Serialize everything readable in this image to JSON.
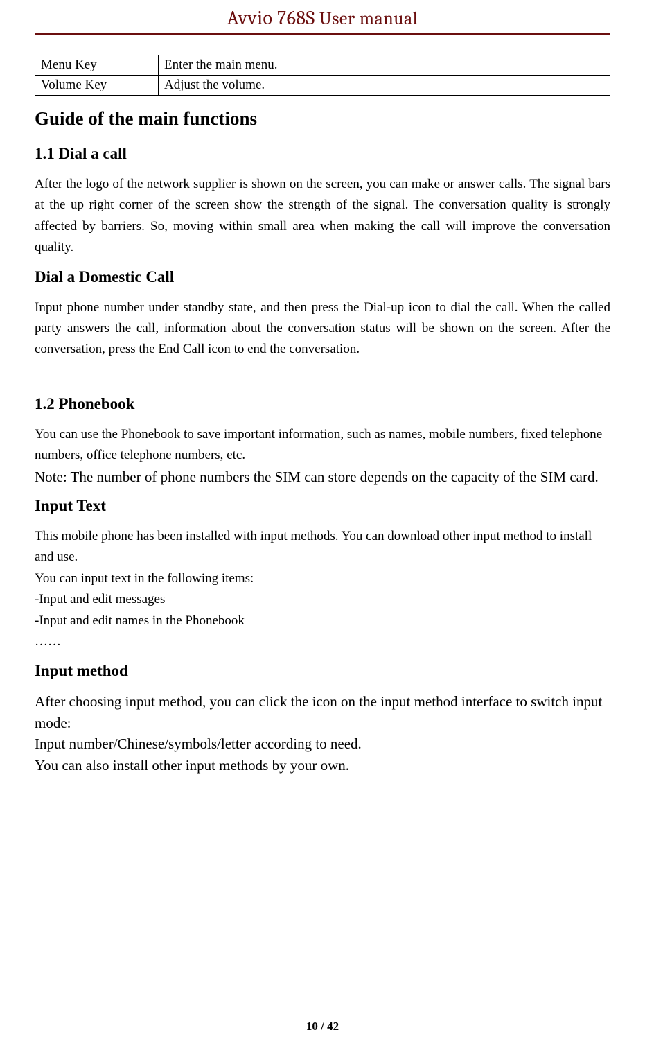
{
  "header": {
    "title_model": "Avvio 768S",
    "title_manual": " User manual"
  },
  "table": {
    "rows": [
      {
        "key": "Menu Key",
        "desc": "Enter the main menu."
      },
      {
        "key": "Volume Key",
        "desc": "Adjust the volume."
      }
    ]
  },
  "section": {
    "main_title": "Guide of the main functions",
    "s1_1_title": "1.1 Dial a call",
    "s1_1_para": "After the logo of the network supplier is shown on the screen, you can make or answer calls. The signal bars at the up right corner of the screen show the strength of the signal. The conversation quality is strongly affected by barriers. So, moving within small area when making the call will improve the conversation quality.",
    "domestic_title": "Dial a Domestic Call",
    "domestic_para": "Input phone number under standby state, and then press the Dial-up icon to dial the call. When the called party answers the call, information about the conversation status will be shown on the screen. After the conversation, press the End Call icon to end the conversation.",
    "s1_2_title": "1.2 Phonebook",
    "s1_2_para": "You can use the Phonebook to save important information, such as names, mobile numbers, fixed telephone numbers, office telephone numbers, etc.",
    "s1_2_note": "Note: The number of phone numbers the SIM can store depends on the capacity of the SIM card.",
    "input_text_title": "Input Text",
    "input_text_para1": "This mobile phone has been installed with input methods. You can download other input method to install and use.",
    "input_text_para2": "You can input text in the following items:",
    "input_text_item1": "-Input and edit messages",
    "input_text_item2": "-Input and edit names in the Phonebook",
    "input_text_ellipsis": "……",
    "input_method_title": "Input method",
    "input_method_para1": "After choosing input method, you can click the icon on the input method interface to switch input mode:",
    "input_method_para2": "Input number/Chinese/symbols/letter according to need.",
    "input_method_para3": "You can also install other input methods by your own."
  },
  "footer": {
    "page": "10 / 42"
  }
}
